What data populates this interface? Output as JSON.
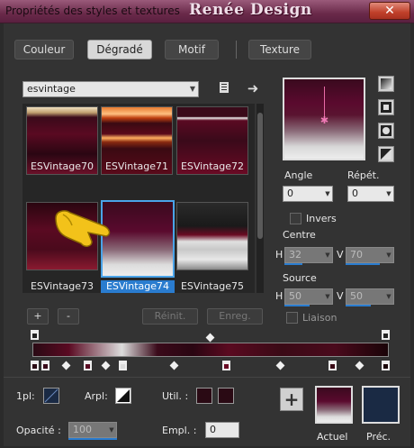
{
  "window": {
    "title": "Propriétés des styles et textures",
    "watermark": "Renée Design",
    "close_label": "✕"
  },
  "tabs": [
    {
      "label": "Couleur"
    },
    {
      "label": "Dégradé"
    },
    {
      "label": "Motif"
    },
    {
      "label": "Texture"
    }
  ],
  "active_tab": "Dégradé",
  "gradient_select": {
    "value": "esvintage"
  },
  "gradients": [
    {
      "label": "ESVintage70"
    },
    {
      "label": "ESVintage71"
    },
    {
      "label": "ESVintage72"
    },
    {
      "label": "ESVintage73"
    },
    {
      "label": "ESVintage74"
    },
    {
      "label": "ESVintage75"
    }
  ],
  "selected_gradient": "ESVintage74",
  "buttons": {
    "add": "+",
    "remove": "-",
    "reinit": "Réinit.",
    "enreg": "Enreg."
  },
  "angle": {
    "label": "Angle",
    "value": "0"
  },
  "repeat": {
    "label": "Répét.",
    "value": "0"
  },
  "invert": {
    "label": "Invers",
    "checked": false
  },
  "center": {
    "label": "Centre",
    "h_label": "H",
    "h_value": "32",
    "v_label": "V",
    "v_value": "70"
  },
  "source": {
    "label": "Source",
    "h_label": "H",
    "h_value": "50",
    "v_label": "V",
    "v_value": "50"
  },
  "link": {
    "label": "Liaison",
    "checked": false
  },
  "bottom": {
    "one_pl_label": "1pl:",
    "arpl_label": "Arpl:",
    "util_label": "Util. :",
    "opacity_label": "Opacité :",
    "opacity_value": "100",
    "empl_label": "Empl. :",
    "empl_value": "0",
    "actual_label": "Actuel",
    "prev_label": "Préc."
  },
  "colors": {
    "accent": "#2a7ccf",
    "previous_swatch": "#1a2a44",
    "util_swatch": "#2a0a14"
  }
}
